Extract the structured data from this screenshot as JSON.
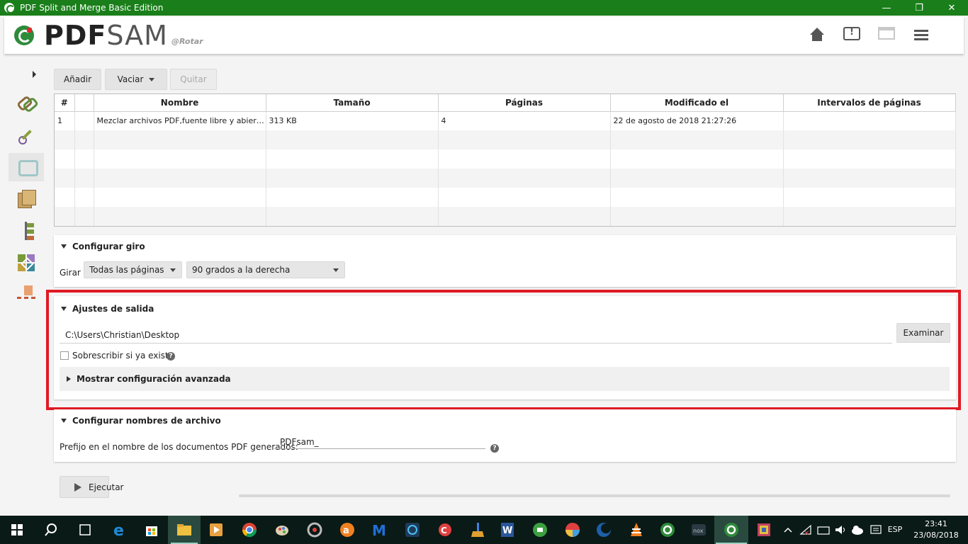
{
  "window": {
    "title": "PDF Split and Merge Basic Edition",
    "minimize": "—",
    "maximize": "❐",
    "close": "✕"
  },
  "header": {
    "logo_pdf": "PDF",
    "logo_sam": "SAM",
    "subtitle": "@Rotar"
  },
  "toolbar": {
    "add_label": "Añadir",
    "clear_label": "Vaciar",
    "remove_label": "Quitar"
  },
  "table": {
    "columns": [
      "#",
      "",
      "Nombre",
      "Tamaño",
      "Páginas",
      "Modificado el",
      "Intervalos de páginas"
    ],
    "rows": [
      {
        "num": "1",
        "flag": "",
        "name": "Mezclar archivos PDF,fuente libre y abierta.pdf",
        "size": "313 KB",
        "pages": "4",
        "modified": "22 de agosto de 2018 21:27:26",
        "ranges": ""
      }
    ]
  },
  "rotate": {
    "title": "Configurar giro",
    "label": "Girar",
    "pages_option": "Todas las páginas",
    "degrees_option": "90 grados a la derecha"
  },
  "output": {
    "title": "Ajustes de salida",
    "path": "C:\\Users\\Christian\\Desktop",
    "browse_label": "Examinar",
    "overwrite_label": "Sobrescribir si ya existe",
    "overwrite_checked": false,
    "advanced_label": "Mostrar configuración avanzada"
  },
  "filenames": {
    "title": "Configurar nombres de archivo",
    "prefix_label": "Prefijo en el nombre de los documentos PDF generados:",
    "prefix_value": "PDFsam_"
  },
  "run": {
    "label": "Ejecutar"
  },
  "taskbar": {
    "language": "ESP",
    "time": "23:41",
    "date": "23/08/2018"
  },
  "colors": {
    "title_bar": "#1a7f1a",
    "highlight": "#e01a24",
    "taskbar": "#0a1a16"
  }
}
